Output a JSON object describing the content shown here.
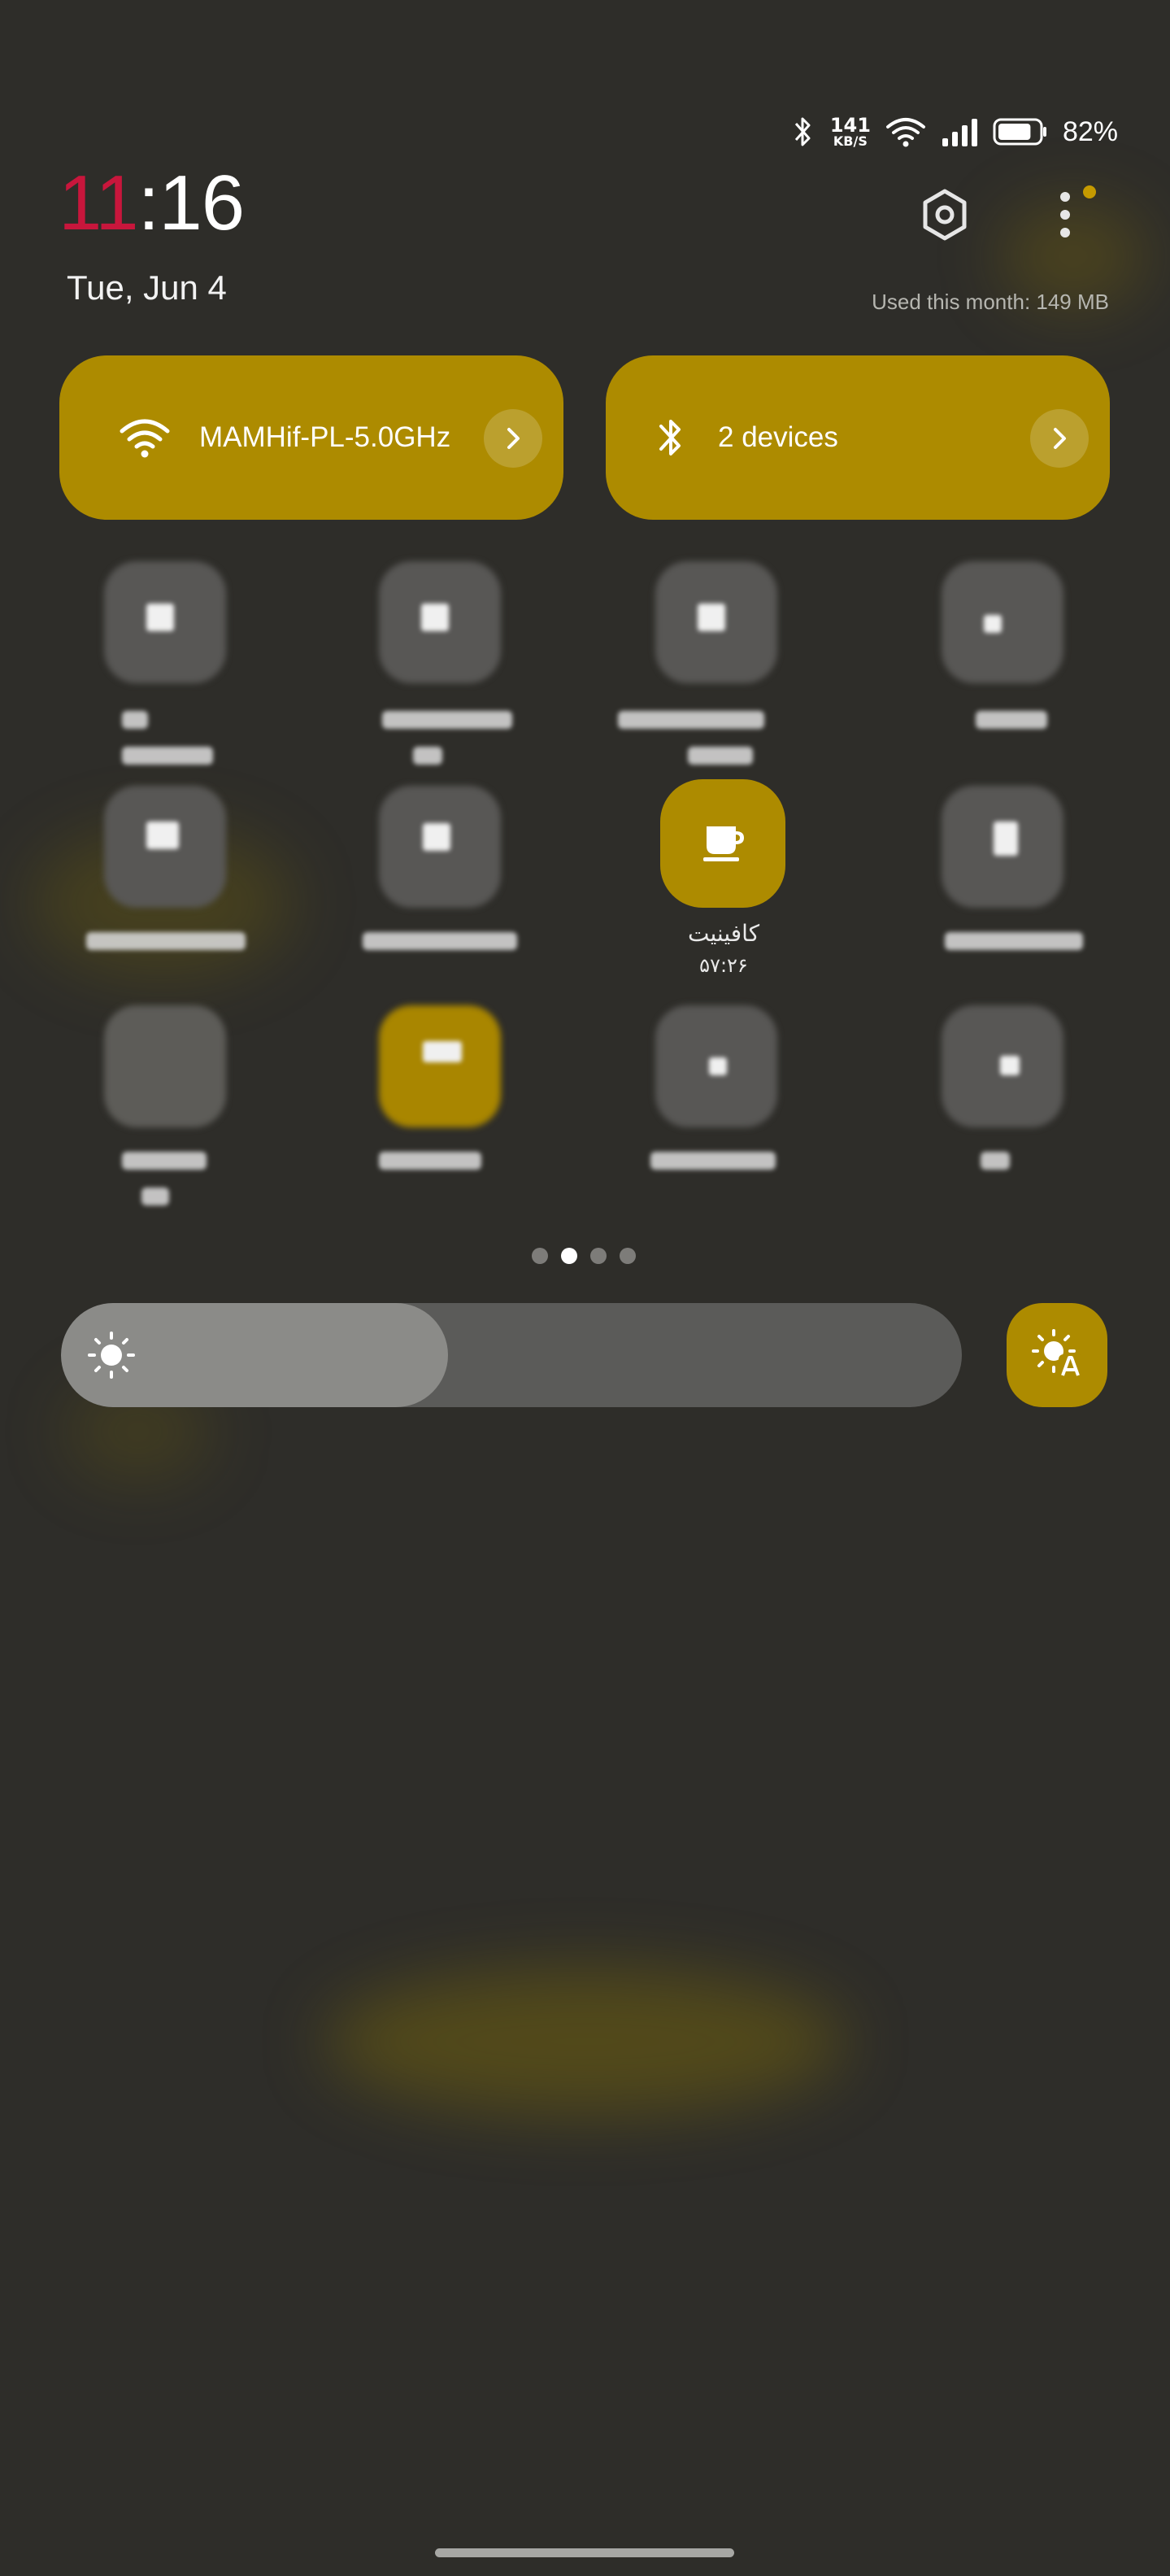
{
  "status_bar": {
    "net_speed_value": "141",
    "net_speed_unit": "KB/S",
    "battery_level_pct": 82,
    "battery_text": "82%",
    "icons": [
      "bluetooth-icon",
      "wifi-icon",
      "signal-icon",
      "battery-icon"
    ]
  },
  "clock": {
    "hour": "11",
    "sep_min": ":16"
  },
  "date": "Tue, Jun 4",
  "data_usage": "Used this month: 149 MB",
  "top_actions": {
    "icons": [
      "settings-icon",
      "more-icon"
    ],
    "notification_dot_color": "#c59a00"
  },
  "wifi_tile": {
    "label": "MAMHif-PL-5.0GHz",
    "icon": "wifi-icon"
  },
  "bluetooth_tile": {
    "label": "2 devices",
    "icon": "bluetooth-icon"
  },
  "caffeine_tile": {
    "label": "کافینیت",
    "sublabel": "۵۷:۲۶",
    "icon": "cup-icon"
  },
  "pagination": {
    "count": 4,
    "active_index": 1
  },
  "brightness": {
    "level": 0.43,
    "icons": [
      "sun-icon",
      "auto-brightness-icon"
    ]
  },
  "colors": {
    "accent": "#ad8b00",
    "clock_hour": "#c8163c",
    "background": "#2e2d29"
  }
}
